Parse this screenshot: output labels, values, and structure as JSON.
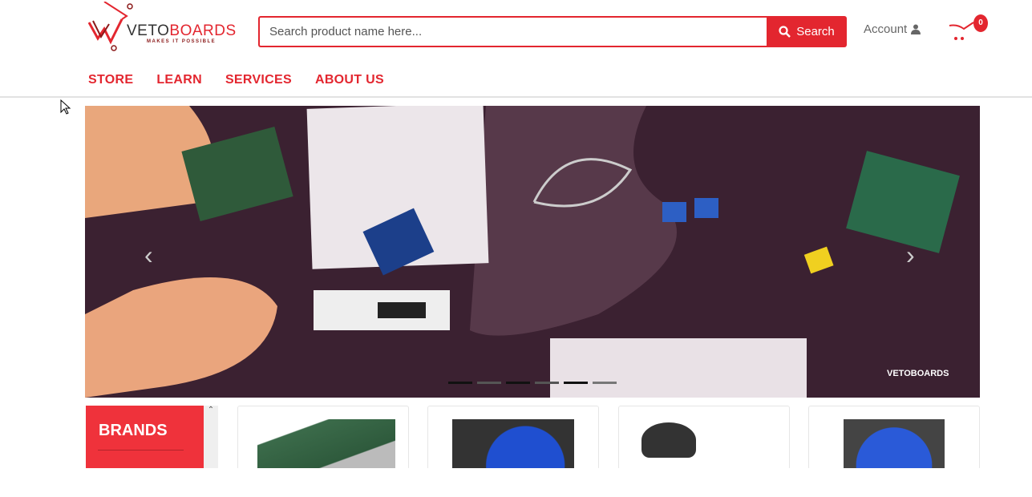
{
  "header": {
    "logo_text_dark": "VETO",
    "logo_text_red": "BOARDS",
    "logo_tagline": "MAKES IT POSSIBLE",
    "search_placeholder": "Search product name here...",
    "search_label": "Search",
    "account_label": "Account",
    "cart_count": "0"
  },
  "nav": [
    {
      "label": "STORE"
    },
    {
      "label": "LEARN"
    },
    {
      "label": "SERVICES"
    },
    {
      "label": "ABOUT US"
    }
  ],
  "carousel": {
    "slide_count": 6,
    "active_slide": 5,
    "watermark": "VETOBOARDS"
  },
  "sidebar": {
    "brands_title": "BRANDS"
  },
  "products": [
    {
      "icon": "raspberry-pi-board"
    },
    {
      "icon": "blue-sensor-board"
    },
    {
      "icon": "transistor"
    },
    {
      "icon": "blue-module-board"
    }
  ],
  "colors": {
    "accent": "#e3262f",
    "brands_bg": "#ef323b"
  }
}
